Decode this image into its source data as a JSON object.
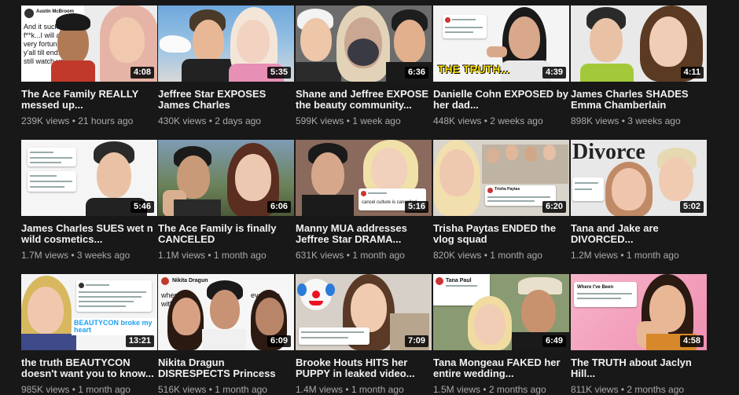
{
  "videos": [
    {
      "title": "The Ace Family REALLY messed up...",
      "views": "239K views",
      "age": "21 hours ago",
      "duration": "4:08",
      "tweet_name": "Austin McBroom",
      "overlay_lines": [
        "And it sucks t",
        "f**k...I will alv",
        "very fortunate",
        "y'all till end.",
        "still watch ur"
      ]
    },
    {
      "title": "Jeffree Star EXPOSES James Charles",
      "views": "430K views",
      "age": "2 days ago",
      "duration": "5:35"
    },
    {
      "title": "Shane and Jeffree EXPOSE the beauty community...",
      "views": "599K views",
      "age": "1 week ago",
      "duration": "6:36"
    },
    {
      "title": "Danielle Cohn EXPOSED by her dad...",
      "views": "448K views",
      "age": "2 weeks ago",
      "duration": "4:39",
      "overlay": "THE TRUTH..."
    },
    {
      "title": "James Charles SHADES Emma Chamberlain",
      "views": "898K views",
      "age": "3 weeks ago",
      "duration": "4:11"
    },
    {
      "title": "James Charles SUES wet n wild cosmetics...",
      "views": "1.7M views",
      "age": "3 weeks ago",
      "duration": "5:46"
    },
    {
      "title": "The Ace Family is finally CANCELED",
      "views": "1.1M views",
      "age": "1 month ago",
      "duration": "6:06"
    },
    {
      "title": "Manny MUA addresses Jeffree Star DRAMA...",
      "views": "631K views",
      "age": "1 month ago",
      "duration": "5:16",
      "tweet_text": "cancel culture is cancelled"
    },
    {
      "title": "Trisha Paytas ENDED the vlog squad",
      "views": "820K views",
      "age": "1 month ago",
      "duration": "6:20",
      "tweet_name": "Trisha Paytas"
    },
    {
      "title": "Tana and Jake are DIVORCED...",
      "views": "1.2M views",
      "age": "1 month ago",
      "duration": "5:02",
      "overlay": "Divorce"
    },
    {
      "title": "the truth BEAUTYCON doesn't want you to know...",
      "views": "985K views",
      "age": "1 month ago",
      "duration": "13:21",
      "overlay": "BEAUTYCON broke my heart"
    },
    {
      "title": "Nikita Dragun DISRESPECTS Princess Mae on camera",
      "views": "516K views",
      "age": "1 month ago",
      "duration": "6:09",
      "tweet_name": "Nikita Dragun",
      "overlay_lines": [
        "when I'm",
        "with handle",
        "everyone",
        "se"
      ]
    },
    {
      "title": "Brooke Houts HITS her PUPPY in leaked video...",
      "views": "1.4M views",
      "age": "1 month ago",
      "duration": "7:09"
    },
    {
      "title": "Tana Mongeau FAKED her entire wedding...",
      "views": "1.5M views",
      "age": "2 months ago",
      "duration": "6:49",
      "tweet_name": "Tana Paul"
    },
    {
      "title": "The TRUTH about Jaclyn Hill...",
      "views": "811K views",
      "age": "2 months ago",
      "duration": "4:58",
      "tweet_text": "Where I've Been"
    }
  ],
  "meta_separator": " • "
}
